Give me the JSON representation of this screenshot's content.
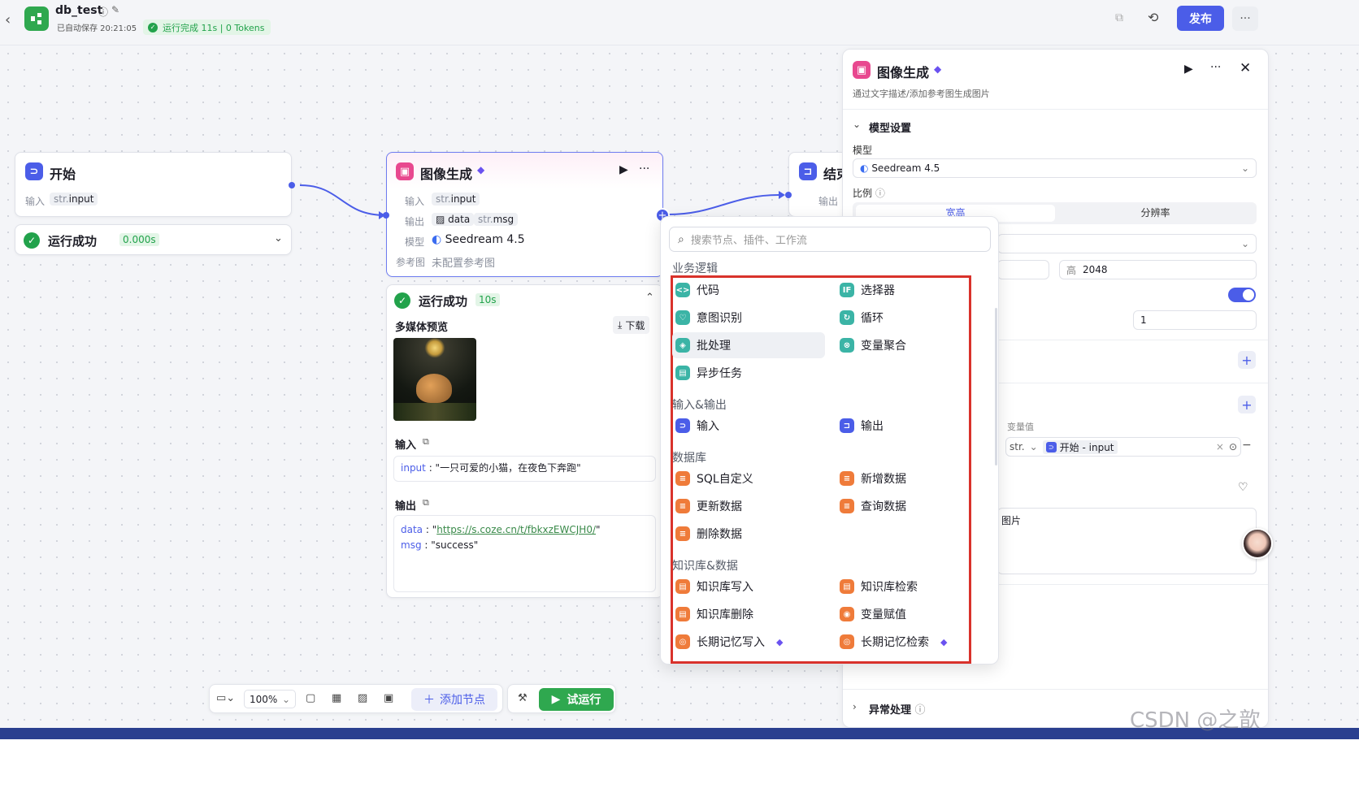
{
  "app": {
    "title": "db_test",
    "autosave": "已自动保存 20:21:05",
    "run_status": "运行完成 11s | 0 Tokens",
    "publish": "发布"
  },
  "start_node": {
    "title": "开始",
    "input_label": "输入",
    "input_type": "str.",
    "input_name": "input",
    "run_status": "运行成功",
    "time": "0.000s"
  },
  "image_node": {
    "title": "图像生成",
    "input_label": "输入",
    "input_type": "str.",
    "input_name": "input",
    "output_label": "输出",
    "output_data": "data",
    "output_type": "str.",
    "output_msg": "msg",
    "model_label": "模型",
    "model_value": "Seedream 4.5",
    "ref_label": "参考图",
    "ref_value": "未配置参考图"
  },
  "end_node": {
    "title": "结束",
    "output_label": "输出"
  },
  "result_panel": {
    "status": "运行成功",
    "time": "10s",
    "preview_title": "多媒体预览",
    "download": "下载",
    "input_title": "输入",
    "input_key": "input",
    "input_value": "\"一只可爱的小猫，在夜色下奔跑\"",
    "output_title": "输出",
    "data_key": "data",
    "data_value": "https://s.coze.cn/t/fbkxzEWCJH0/",
    "msg_key": "msg",
    "msg_value": "\"success\""
  },
  "node_menu": {
    "search_placeholder": "搜索节点、插件、工作流",
    "sections": [
      {
        "title": "业务逻辑",
        "items": [
          {
            "label": "代码",
            "icon": "code-icon"
          },
          {
            "label": "选择器",
            "icon": "if-icon"
          },
          {
            "label": "意图识别",
            "icon": "intent-icon"
          },
          {
            "label": "循环",
            "icon": "loop-icon"
          },
          {
            "label": "批处理",
            "icon": "batch-icon"
          },
          {
            "label": "变量聚合",
            "icon": "aggregate-icon"
          },
          {
            "label": "异步任务",
            "icon": "async-icon"
          }
        ]
      },
      {
        "title": "输入&输出",
        "items": [
          {
            "label": "输入",
            "icon": "input-icon"
          },
          {
            "label": "输出",
            "icon": "output-icon"
          }
        ]
      },
      {
        "title": "数据库",
        "items": [
          {
            "label": "SQL自定义",
            "icon": "sql-icon"
          },
          {
            "label": "新增数据",
            "icon": "db-add-icon"
          },
          {
            "label": "更新数据",
            "icon": "db-update-icon"
          },
          {
            "label": "查询数据",
            "icon": "db-query-icon"
          },
          {
            "label": "删除数据",
            "icon": "db-delete-icon"
          }
        ]
      },
      {
        "title": "知识库&数据",
        "items": [
          {
            "label": "知识库写入",
            "icon": "kb-write-icon"
          },
          {
            "label": "知识库检索",
            "icon": "kb-search-icon"
          },
          {
            "label": "知识库删除",
            "icon": "kb-delete-icon"
          },
          {
            "label": "变量赋值",
            "icon": "var-assign-icon"
          },
          {
            "label": "长期记忆写入",
            "icon": "memory-write-icon"
          },
          {
            "label": "长期记忆检索",
            "icon": "memory-search-icon"
          }
        ]
      }
    ]
  },
  "right_panel": {
    "title": "图像生成",
    "desc": "通过文字描述/添加参考图生成图片",
    "section": "模型设置",
    "model_label": "模型",
    "model_value": "Seedream 4.5",
    "ratio_label": "比例",
    "tab_ratio": "宽高",
    "tab_res": "分辨率",
    "height_label": "高",
    "height_value": "2048",
    "count_value": "1",
    "var_value_label": "变量值",
    "var_type": "str.",
    "var_ref": "开始 - input",
    "prompt_fragment": "图片",
    "error_section": "异常处理"
  },
  "toolbar": {
    "zoom": "100%",
    "add_node": "添加节点",
    "test_run": "试运行"
  },
  "watermark": "CSDN @之歆",
  "colors": {
    "accent": "#4b5de8",
    "success": "#22a24b",
    "highlight": "#d9322b"
  }
}
